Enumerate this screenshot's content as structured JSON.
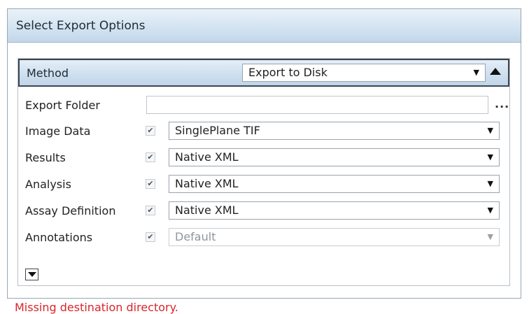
{
  "dialog": {
    "title": "Select Export Options"
  },
  "method": {
    "label": "Method",
    "value": "Export to Disk"
  },
  "export_folder": {
    "label": "Export Folder",
    "value": "",
    "browse_label": "..."
  },
  "rows": [
    {
      "label": "Image Data",
      "checked": true,
      "value": "SinglePlane TIF",
      "enabled": true
    },
    {
      "label": "Results",
      "checked": true,
      "value": "Native XML",
      "enabled": true
    },
    {
      "label": "Analysis",
      "checked": true,
      "value": "Native XML",
      "enabled": true
    },
    {
      "label": "Assay Definition",
      "checked": true,
      "value": "Native XML",
      "enabled": true
    },
    {
      "label": "Annotations",
      "checked": true,
      "value": "Default",
      "enabled": false
    }
  ],
  "error": {
    "message": "Missing destination directory."
  },
  "icons": {
    "dropdown": "caret-down-icon",
    "collapse": "triangle-up-icon",
    "expand": "triangle-down-icon",
    "check": "checkmark-icon"
  }
}
